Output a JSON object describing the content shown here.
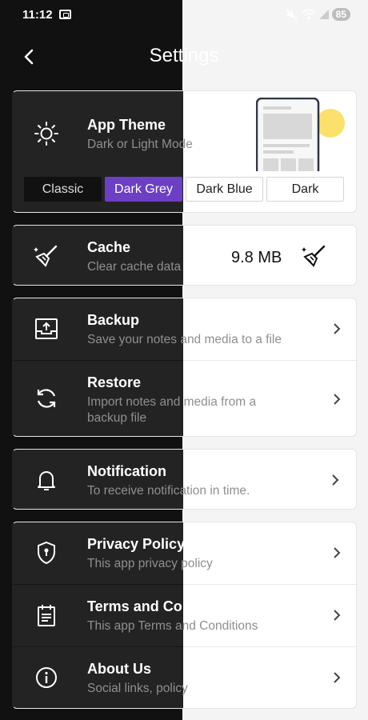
{
  "status_bar": {
    "time": "11:12",
    "battery": "85"
  },
  "header": {
    "title": "Settings"
  },
  "theme": {
    "title": "App Theme",
    "subtitle": "Dark or Light Mode",
    "options": [
      "Classic",
      "Dark Grey",
      "Dark Blue",
      "Dark"
    ],
    "selected": "Dark Grey"
  },
  "cache": {
    "title": "Cache",
    "subtitle": "Clear cache data",
    "size": "9.8 MB"
  },
  "backup": {
    "title": "Backup",
    "subtitle": "Save your notes and media to a file"
  },
  "restore": {
    "title": "Restore",
    "subtitle": "Import notes and media from a backup file"
  },
  "notification": {
    "title": "Notification",
    "subtitle": "To receive notification in time."
  },
  "privacy": {
    "title": "Privacy Policy",
    "subtitle": "This app privacy policy"
  },
  "terms": {
    "title": "Terms and Conditions",
    "subtitle": "This app Terms and Conditions"
  },
  "about": {
    "title": "About Us",
    "subtitle": "Social links, policy"
  },
  "colors": {
    "accent": "#6c3fc5",
    "dark_bg": "#111111",
    "card_dark": "#232323",
    "light_bg": "#f4f4f4",
    "sun": "#fbe06b"
  }
}
